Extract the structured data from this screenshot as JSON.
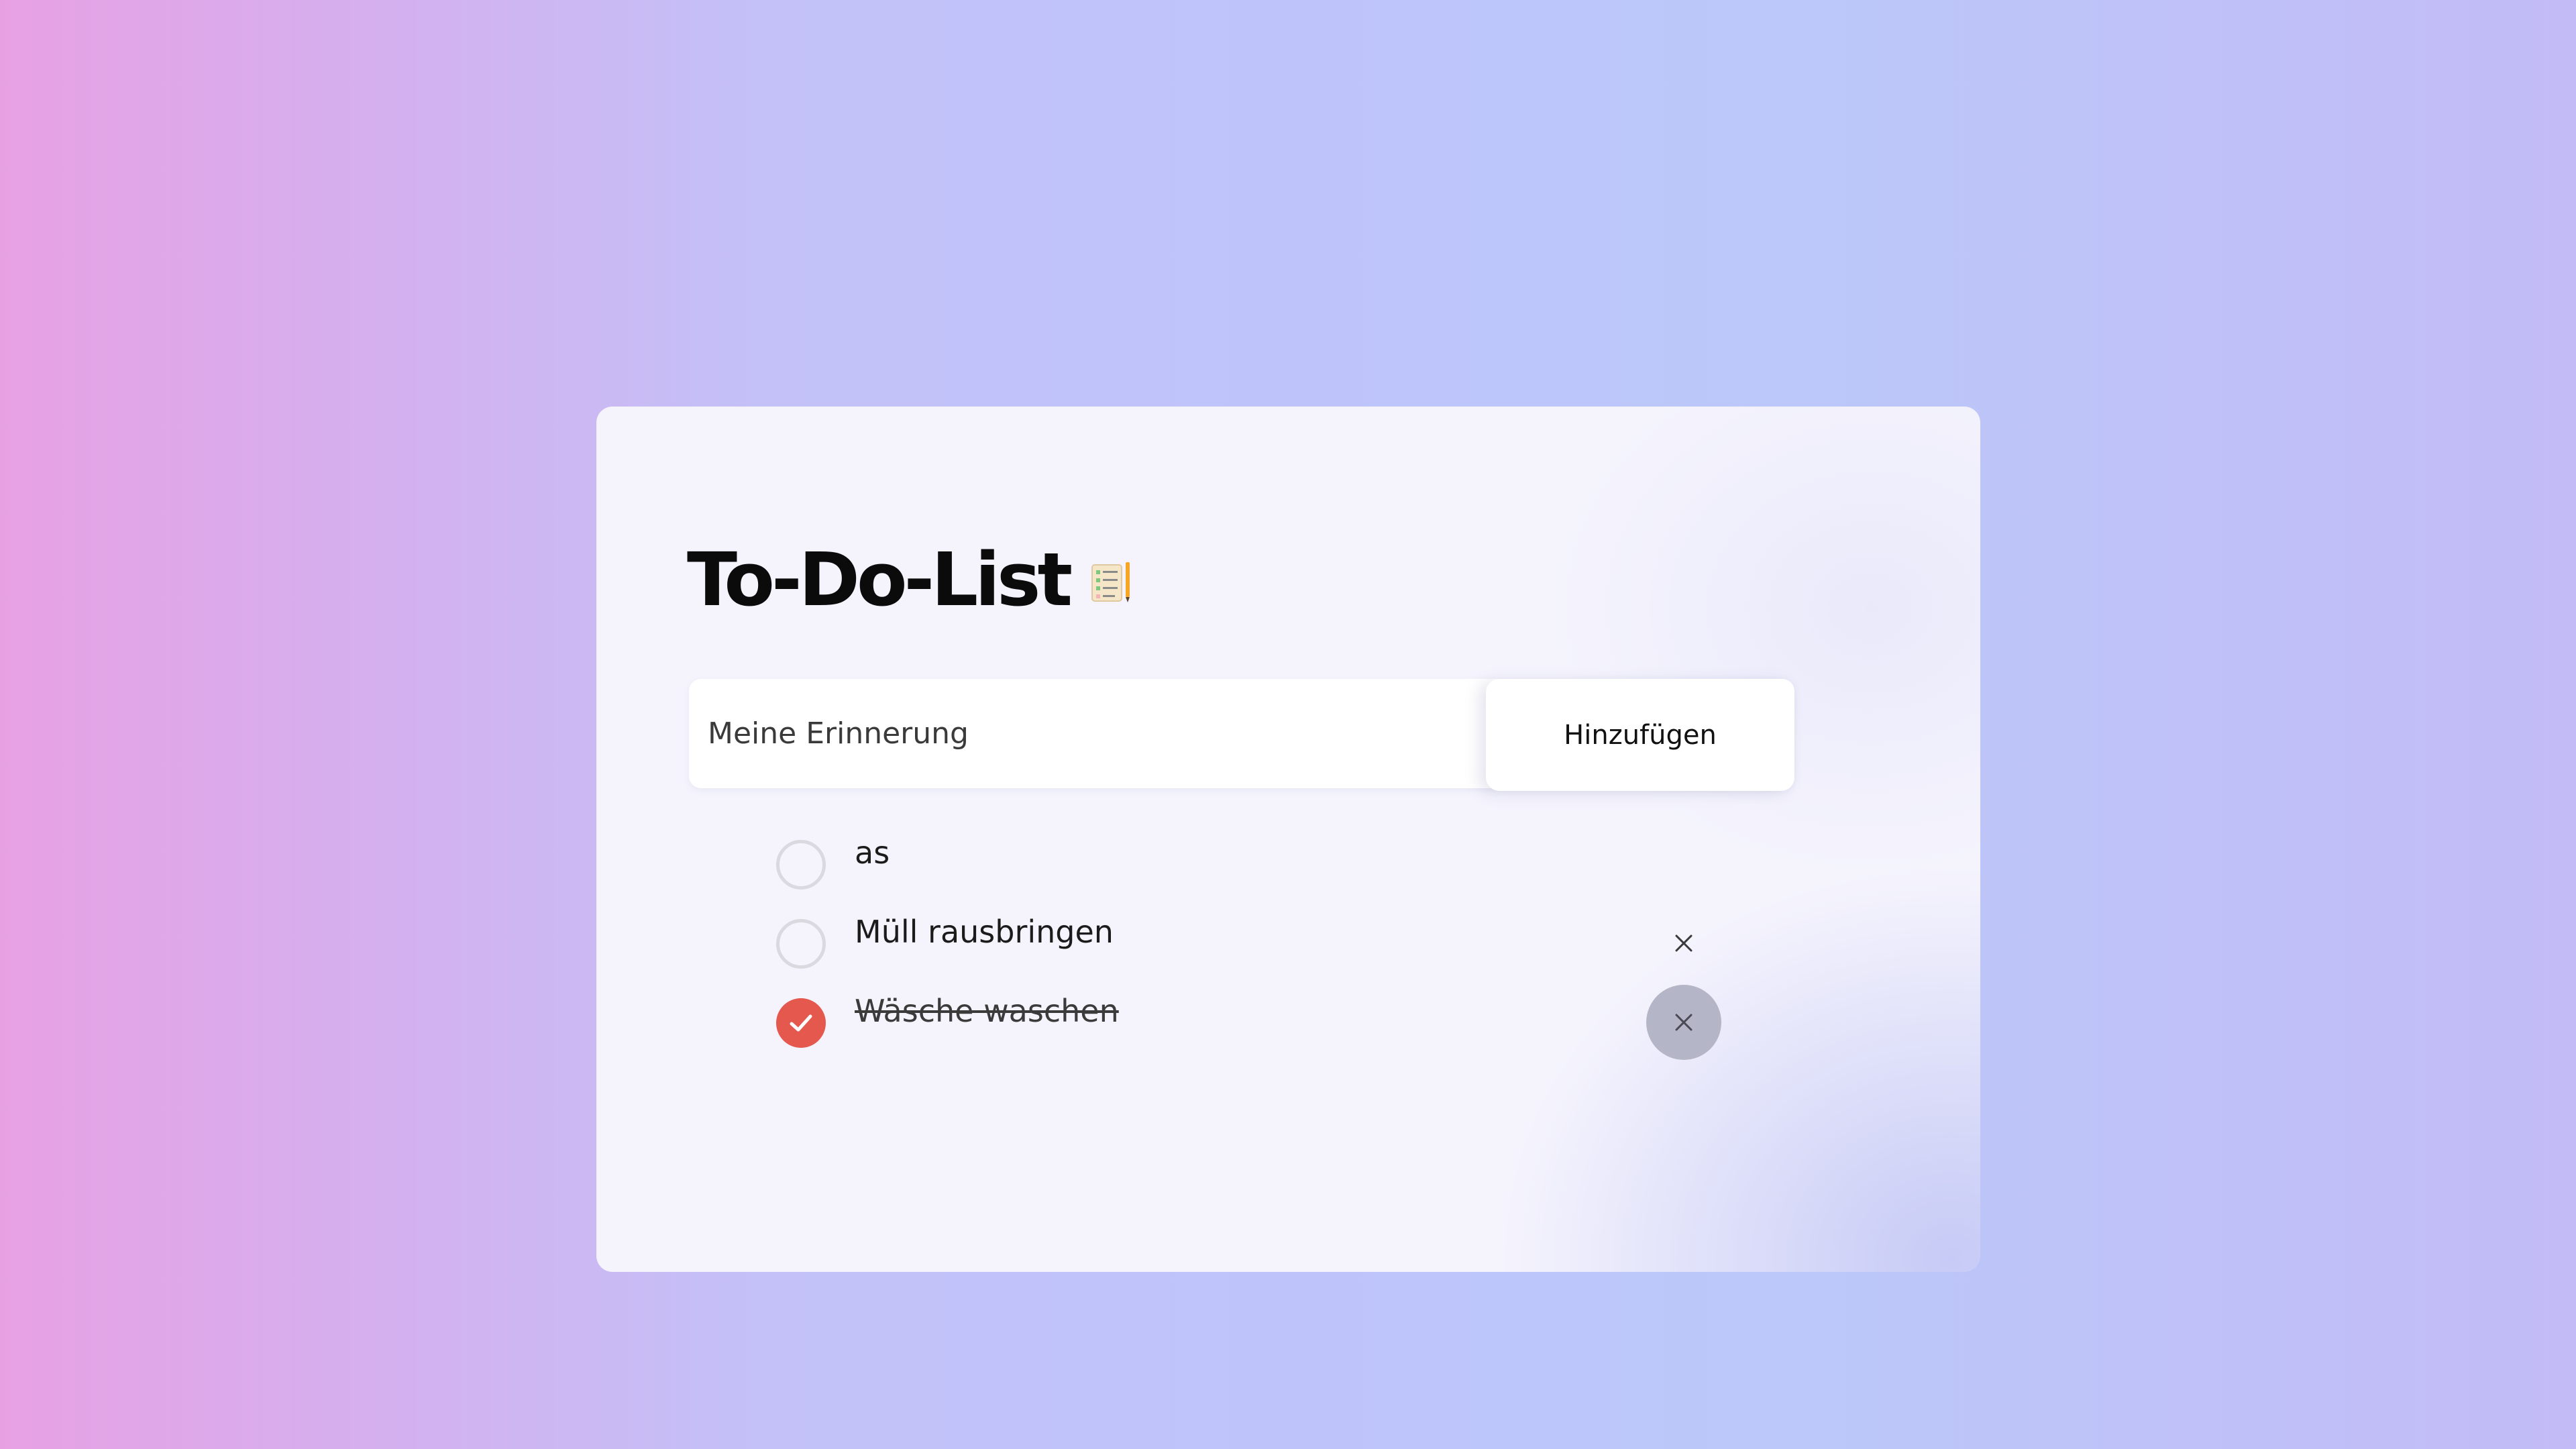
{
  "app": {
    "title": "To-Do-List",
    "title_icon": "notepad-checklist-icon"
  },
  "input": {
    "placeholder": "Meine Erinnerung",
    "value": ""
  },
  "add_button": {
    "label": "Hinzufügen"
  },
  "todos": [
    {
      "text": "as",
      "done": false,
      "delete_icon": "close-icon",
      "delete_visible": false
    },
    {
      "text": "Müll rausbringen",
      "done": false,
      "delete_icon": "close-icon",
      "delete_visible": true
    },
    {
      "text": "Wäsche waschen",
      "done": true,
      "delete_icon": "close-icon",
      "delete_visible": true,
      "delete_hovered": true
    }
  ],
  "colors": {
    "accent_done": "#e4584e",
    "checkbox_border": "#d9d9df",
    "delete_hover_bg": "#b4b6c8"
  }
}
